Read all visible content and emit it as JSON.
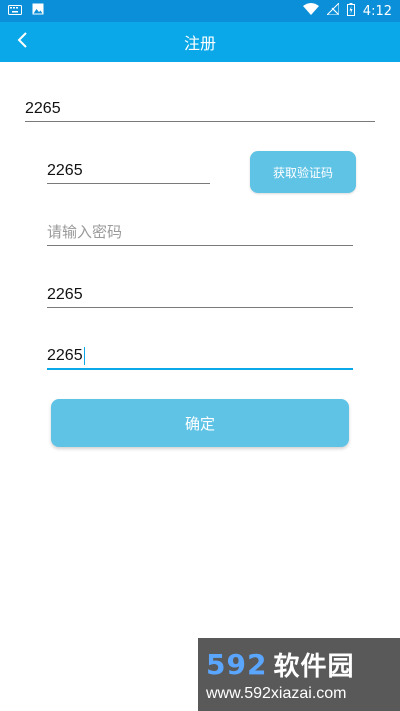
{
  "status_bar": {
    "time": "4:12",
    "left_icons": [
      "keyboard-icon",
      "image-icon"
    ],
    "right_icons": [
      "wifi-icon",
      "no-signal-icon",
      "battery-icon"
    ]
  },
  "app_bar": {
    "title": "注册",
    "back_icon": "chevron-left-icon"
  },
  "form": {
    "phone_value": "2265",
    "code_value": "2265",
    "get_code_label": "获取验证码",
    "password_placeholder": "请输入密码",
    "password_value": "",
    "field4_value": "2265",
    "field5_value": "2265",
    "confirm_label": "确定"
  },
  "watermark": {
    "brand_number": "592",
    "brand_text": "软件园",
    "url": "www.592xiazai.com"
  },
  "colors": {
    "status_bar": "#0a8fd8",
    "app_bar": "#0aa8e8",
    "button": "#5fc3e6",
    "focus": "#0aa8e8"
  }
}
